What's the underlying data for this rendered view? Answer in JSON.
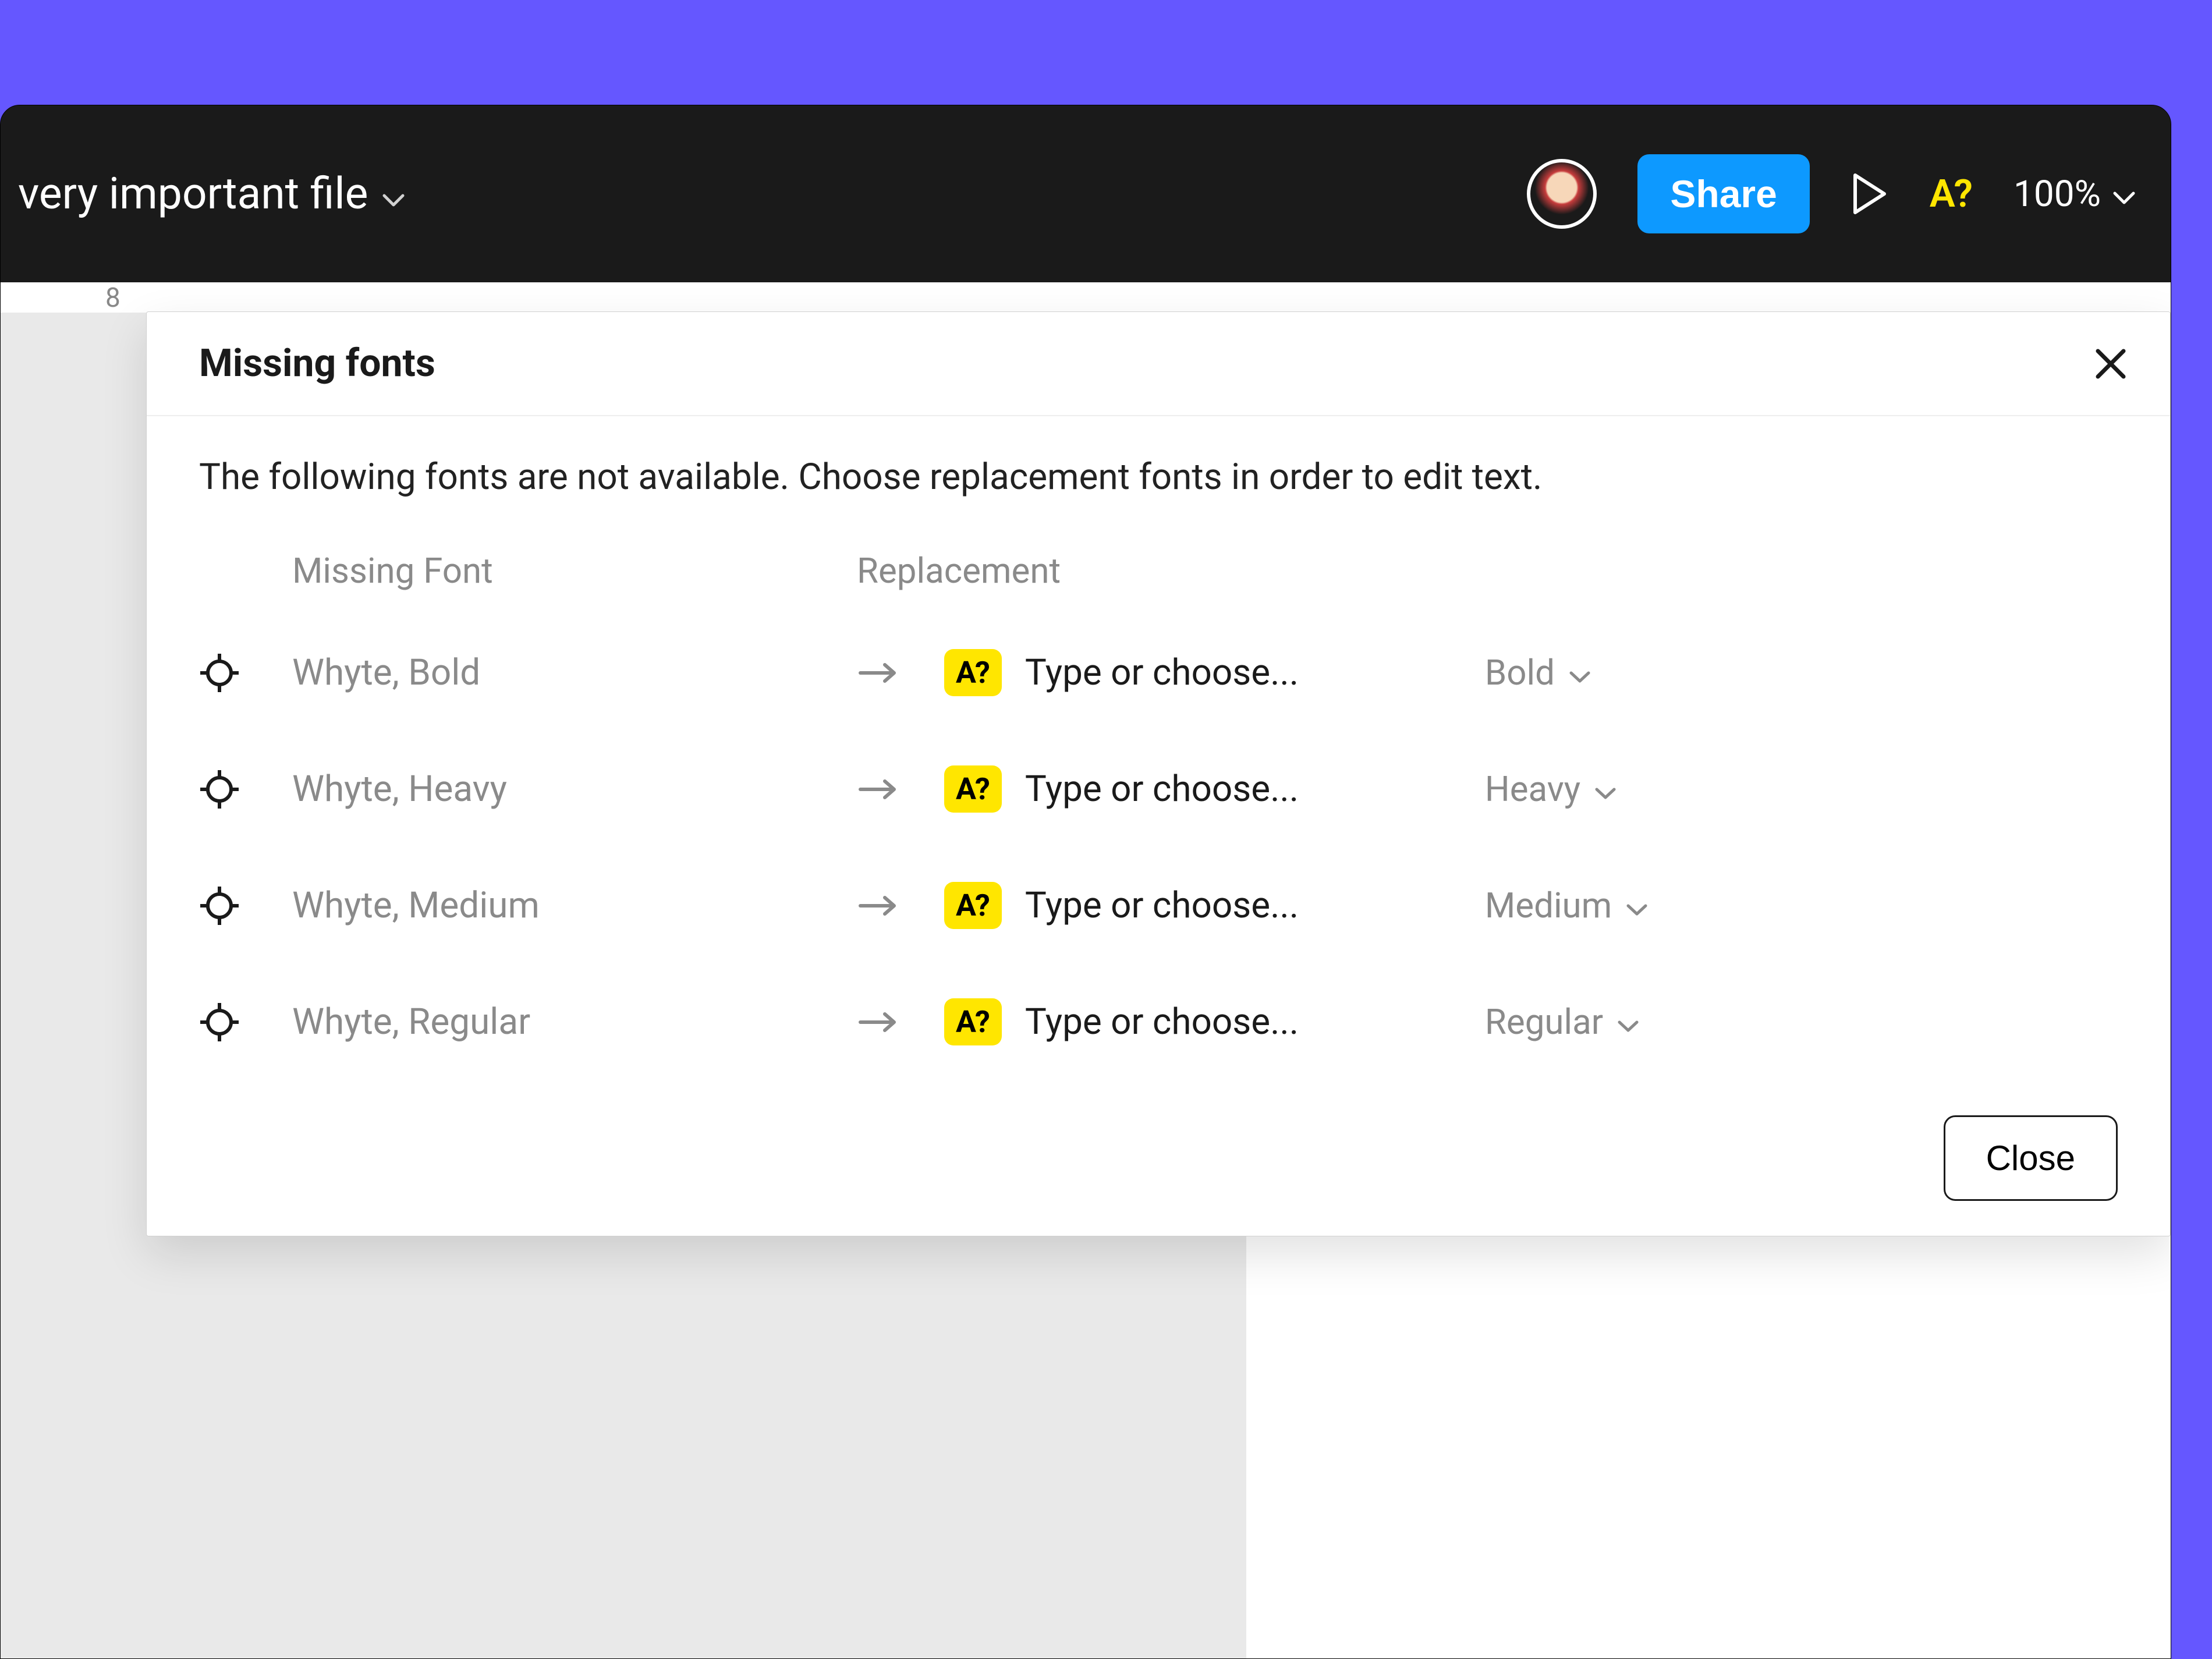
{
  "topbar": {
    "file_name": "very important file",
    "share_label": "Share",
    "missing_fonts_indicator": "A?",
    "zoom_label": "100%"
  },
  "canvas": {
    "ruler_tick_label": "8"
  },
  "modal": {
    "title": "Missing fonts",
    "description": "The following fonts are not available. Choose replacement fonts in order to edit text.",
    "col_missing_header": "Missing Font",
    "col_replacement_header": "Replacement",
    "badge_text": "A?",
    "replacement_placeholder": "Type or choose...",
    "rows": [
      {
        "name": "Whyte, Bold",
        "weight": "Bold"
      },
      {
        "name": "Whyte, Heavy",
        "weight": "Heavy"
      },
      {
        "name": "Whyte, Medium",
        "weight": "Medium"
      },
      {
        "name": "Whyte, Regular",
        "weight": "Regular"
      }
    ],
    "close_label": "Close"
  },
  "colors": {
    "page_bg": "#6557ff",
    "accent_blue": "#0d99ff",
    "warning_yellow": "#FFE600"
  }
}
